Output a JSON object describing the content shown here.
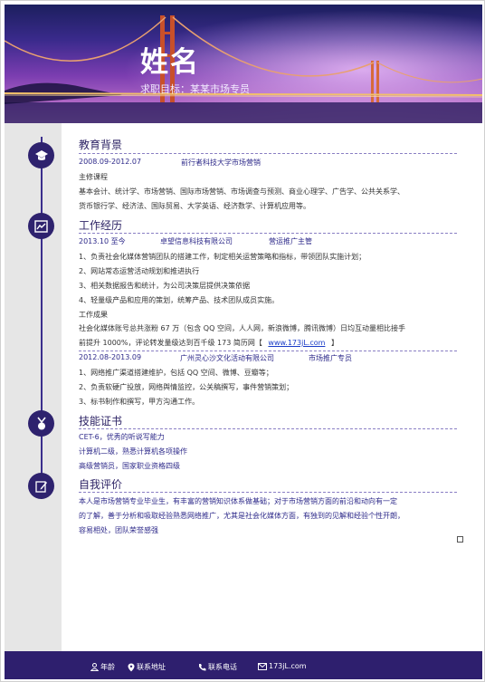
{
  "header": {
    "name": "姓名",
    "objective": "求职目标：某某市场专员"
  },
  "sections": {
    "education": {
      "title": "教育背景",
      "period": "2008.09-2012.07",
      "school": "前行者科技大学市场营销",
      "courses_title": "主修课程",
      "courses_1": "基本会计、统计学、市场营销、国际市场营销、市场调查与预测、商业心理学、广告学、公共关系学、",
      "courses_2": "货币银行学、经济法、国际贸易、大学英语、经济数学、计算机应用等。"
    },
    "work": {
      "title": "工作经历",
      "job1": {
        "period": "2013.10 至今",
        "company": "卓望信息科技有限公司",
        "position": "营运推广主管",
        "items": [
          "1、负责社会化媒体营销团队的搭建工作，制定相关运营策略和指标，带领团队实施计划；",
          "2、网站常态运营活动规划和推进执行",
          "3、相关数据报告和统计，为公司决策层提供决策依据",
          "4、轻量级产品和应用的策划，统筹产品、技术团队成员实施。"
        ],
        "results_title": "工作成果",
        "results_1": "社会化媒体账号总共涨粉 67 万（包含 QQ 空间，人人网，新浪微博，腾讯微博）日均互动量相比接手",
        "results_2_pre": "前提升 1000%，评论转发量级达到百千级 173 简历网【",
        "results_2_link": "www.173jL.com",
        "results_2_post": "】"
      },
      "job2": {
        "period": "2012.08-2013.09",
        "company": "广州灵心沙文化活动有限公司",
        "position": "市场推广专员",
        "items": [
          "1、网络推广渠道搭建维护，包括 QQ 空间、微博、豆瓣等；",
          "2、负责软硬广投放，网络舆情监控，公关稿撰写，事件营销策划；",
          "3、标书制作和撰写，甲方沟通工作。"
        ]
      }
    },
    "skills": {
      "title": "技能证书",
      "items": [
        "CET-6，优秀的听说写能力",
        "计算机二级，熟悉计算机各项操作",
        "高级营销员，国家职业资格四级"
      ]
    },
    "self": {
      "title": "自我评价",
      "lines": [
        "本人是市场营销专业毕业生，有丰富的营销知识体系做基础；对于市场营销方面的前沿和动向有一定",
        "的了解，善于分析和吸取经验熟悉网络推广，尤其是社会化媒体方面，有独到的见解和经验个性开朗，",
        "容易相处，团队荣誉感强"
      ]
    }
  },
  "footer": {
    "age": "年龄",
    "address": "联系地址",
    "phone": "联系电话",
    "email": "173jL.com"
  },
  "colors": {
    "accent": "#2e226e",
    "footer": "#2e1f6e"
  },
  "icons": [
    "graduation-cap-icon",
    "chart-icon",
    "medal-icon",
    "pencil-icon",
    "person-icon",
    "location-pin-icon",
    "phone-icon",
    "mail-icon"
  ]
}
